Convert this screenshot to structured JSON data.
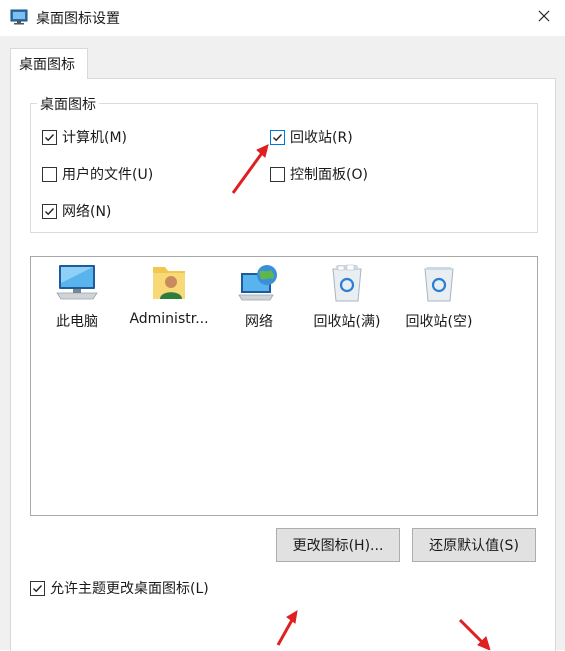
{
  "window": {
    "title": "桌面图标设置"
  },
  "tabs": [
    {
      "label": "桌面图标"
    }
  ],
  "desktop_icons_group": {
    "label": "桌面图标",
    "checkboxes": [
      {
        "label": "计算机(M)",
        "checked": true
      },
      {
        "label": "回收站(R)",
        "checked": true
      },
      {
        "label": "用户的文件(U)",
        "checked": false
      },
      {
        "label": "控制面板(O)",
        "checked": false
      },
      {
        "label": "网络(N)",
        "checked": true
      }
    ]
  },
  "icon_list": [
    {
      "label": "此电脑",
      "icon": "computer-icon"
    },
    {
      "label": "Administr...",
      "icon": "user-folder-icon"
    },
    {
      "label": "网络",
      "icon": "network-icon"
    },
    {
      "label": "回收站(满)",
      "icon": "recycle-bin-full-icon"
    },
    {
      "label": "回收站(空)",
      "icon": "recycle-bin-empty-icon"
    }
  ],
  "buttons": {
    "change_icon": "更改图标(H)...",
    "restore_default": "还原默认值(S)"
  },
  "allow_themes": {
    "label": "允许主题更改桌面图标(L)",
    "checked": true
  },
  "colors": {
    "accent": "#0078d7",
    "annotation_arrow": "#e02020",
    "dialog_bg": "#f0f0f0"
  }
}
